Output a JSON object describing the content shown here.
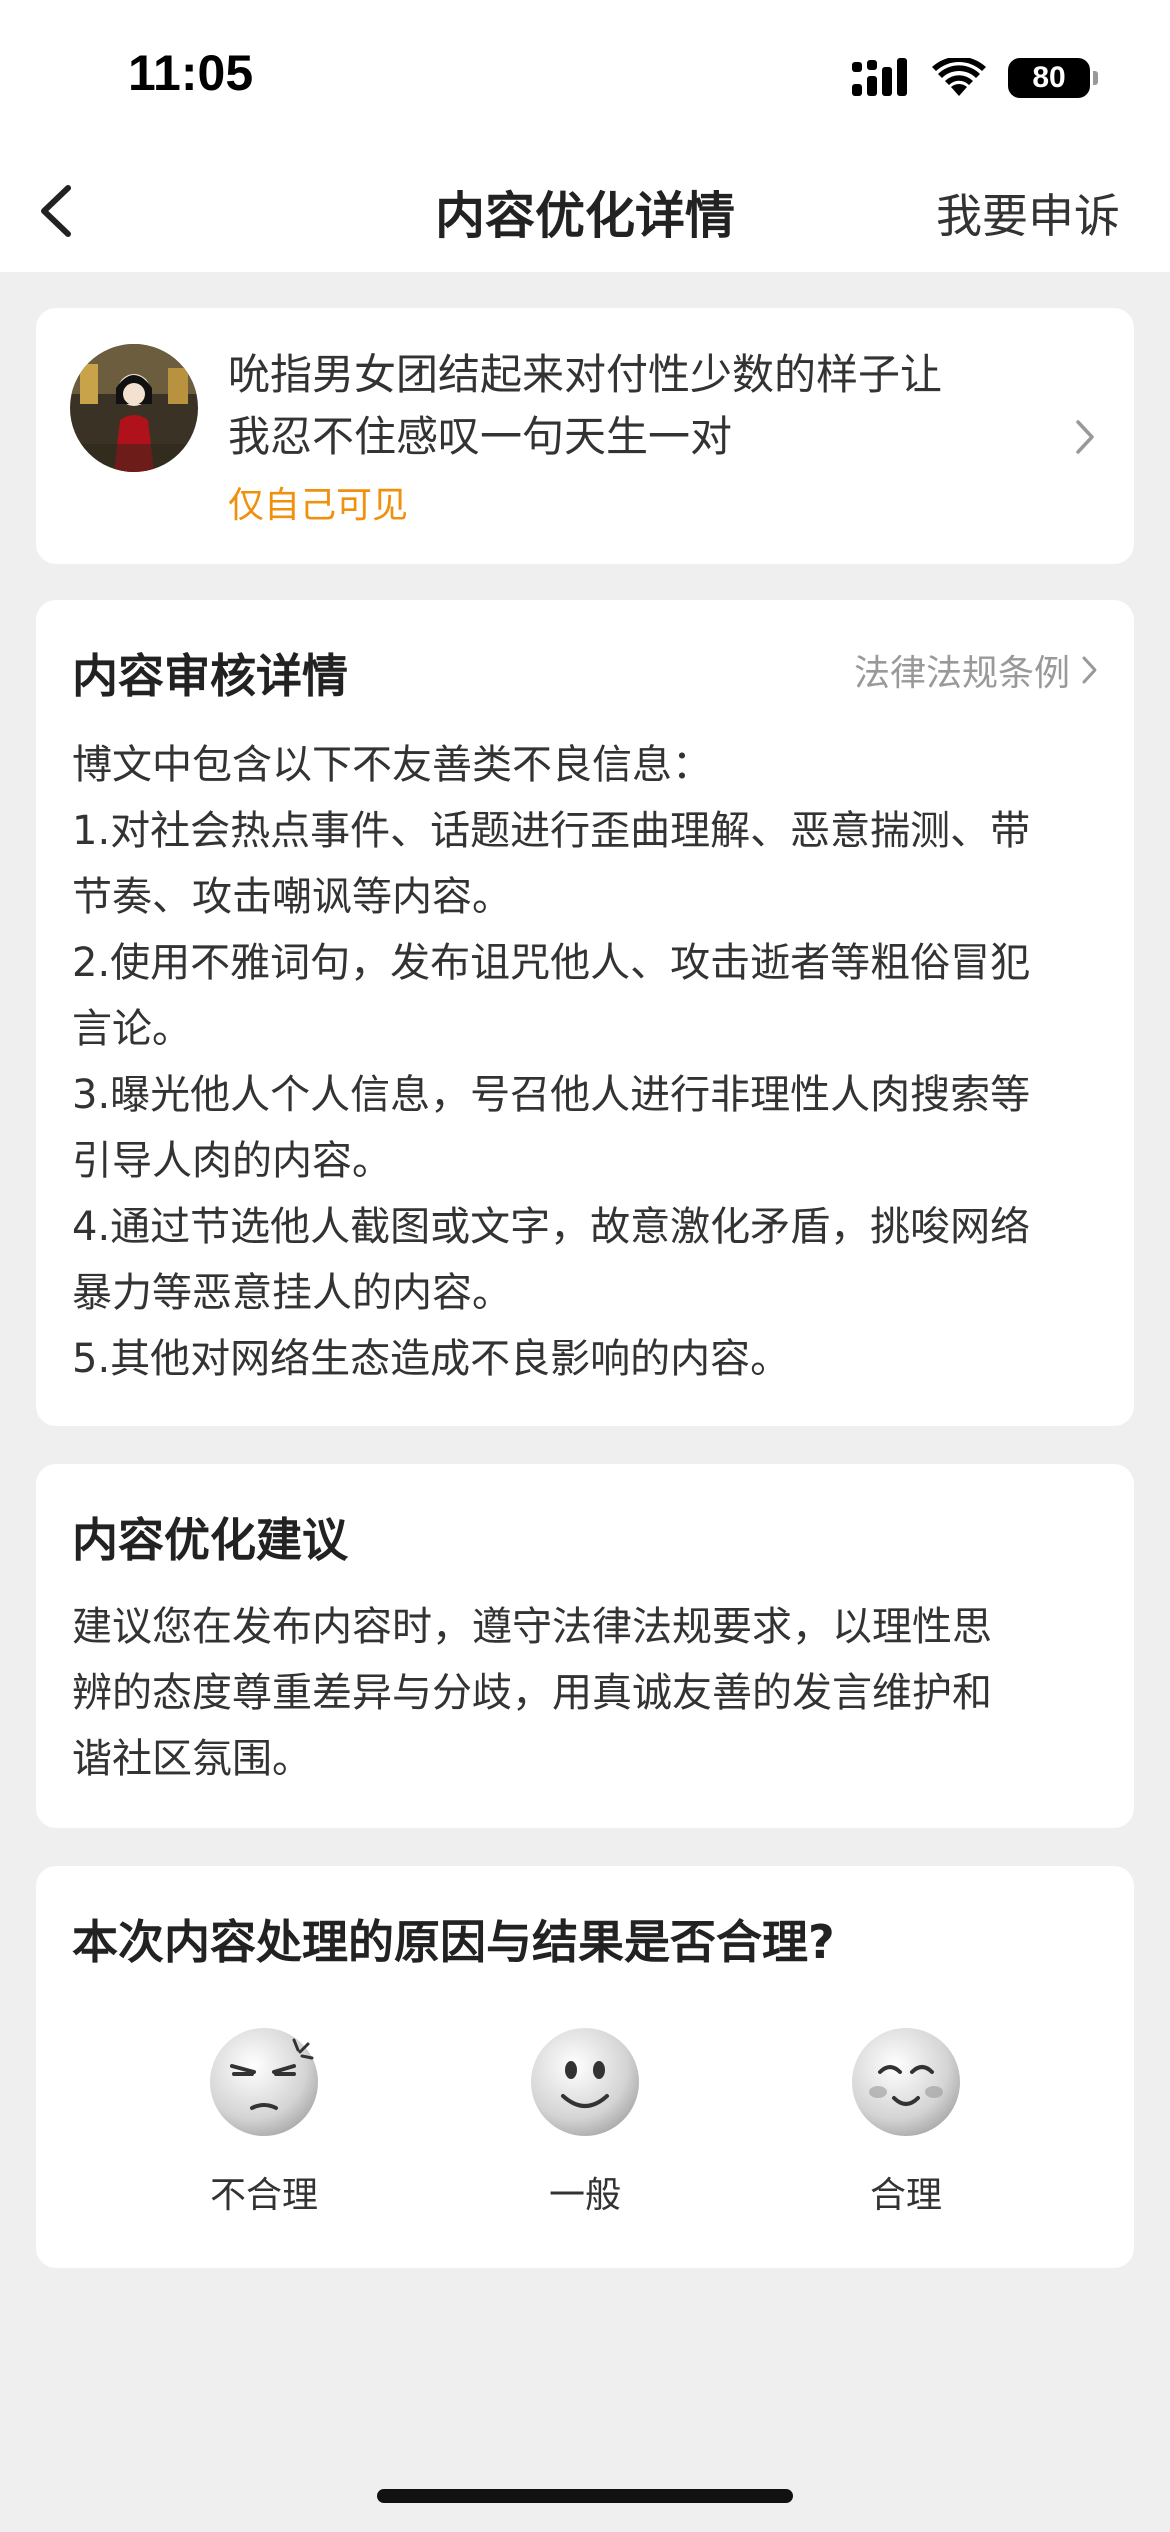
{
  "status_bar": {
    "time": "11:05",
    "battery": "80"
  },
  "nav": {
    "title": "内容优化详情",
    "appeal": "我要申诉"
  },
  "post": {
    "text_line1": "吮指男女团结起来对付性少数的样子让",
    "text_line2": "我忍不住感叹一句天生一对",
    "visibility": "仅自己可见"
  },
  "review": {
    "heading": "内容审核详情",
    "law_link": "法律法规条例",
    "lines": [
      "博文中包含以下不友善类不良信息：",
      "1.对社会热点事件、话题进行歪曲理解、恶意揣测、带",
      "节奏、攻击嘲讽等内容。",
      "2.使用不雅词句，发布诅咒他人、攻击逝者等粗俗冒犯",
      "言论。",
      "3.曝光他人个人信息，号召他人进行非理性人肉搜索等",
      "引导人肉的内容。",
      "4.通过节选他人截图或文字，故意激化矛盾，挑唆网络",
      "暴力等恶意挂人的内容。",
      "5.其他对网络生态造成不良影响的内容。"
    ]
  },
  "suggestion": {
    "heading": "内容优化建议",
    "lines": [
      "建议您在发布内容时，遵守法律法规要求，以理性思",
      "辨的态度尊重差异与分歧，用真诚友善的发言维护和",
      "谐社区氛围。"
    ]
  },
  "rating": {
    "question": "本次内容处理的原因与结果是否合理?",
    "options": [
      {
        "label": "不合理",
        "icon": "angry-face-icon"
      },
      {
        "label": "一般",
        "icon": "neutral-face-icon"
      },
      {
        "label": "合理",
        "icon": "happy-face-icon"
      }
    ]
  },
  "colors": {
    "accent_orange": "#f0900f",
    "background": "#efefef",
    "card": "#ffffff"
  }
}
